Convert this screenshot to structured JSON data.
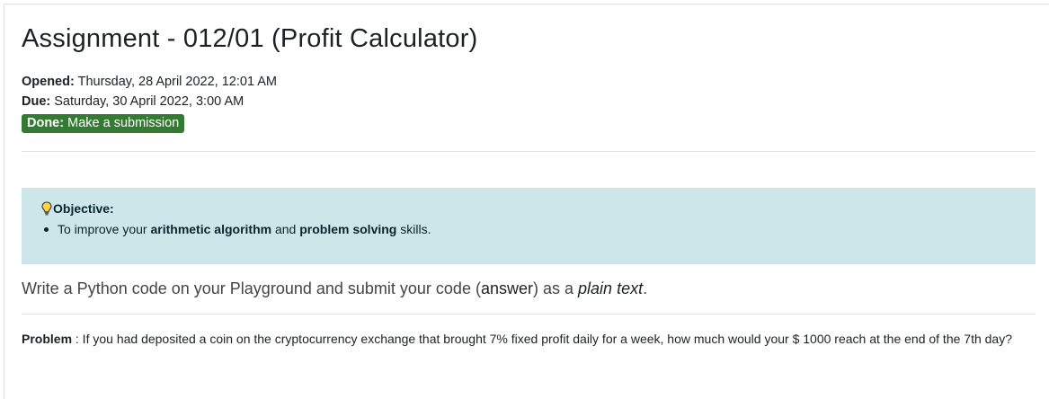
{
  "assignment": {
    "title": "Assignment - 012/01 (Profit Calculator)",
    "opened_label": "Opened:",
    "opened_value": "Thursday, 28 April 2022, 12:01 AM",
    "due_label": "Due:",
    "due_value": "Saturday, 30 April 2022, 3:00 AM",
    "status_label": "Done:",
    "status_value": "Make a submission",
    "status_color": "#357a32"
  },
  "objective": {
    "heading": "Objective:",
    "icon": "lightbulb-icon",
    "bg_color": "#cce6ea",
    "item_pre": "To improve your",
    "item_bold1": "arithmetic algorithm",
    "item_mid": "and",
    "item_bold2": "problem solving",
    "item_post": "skills."
  },
  "instruction": {
    "pre": "Write a Python code on your Playground and submit your code (",
    "answer": "answer",
    "mid": ") as a",
    "italic": "plain text",
    "post": "."
  },
  "problem": {
    "label": "Problem",
    "text": ": If you had deposited a coin on the cryptocurrency exchange that brought 7% fixed profit daily for a week, how much would your $ 1000 reach at the end of the 7th day?"
  }
}
